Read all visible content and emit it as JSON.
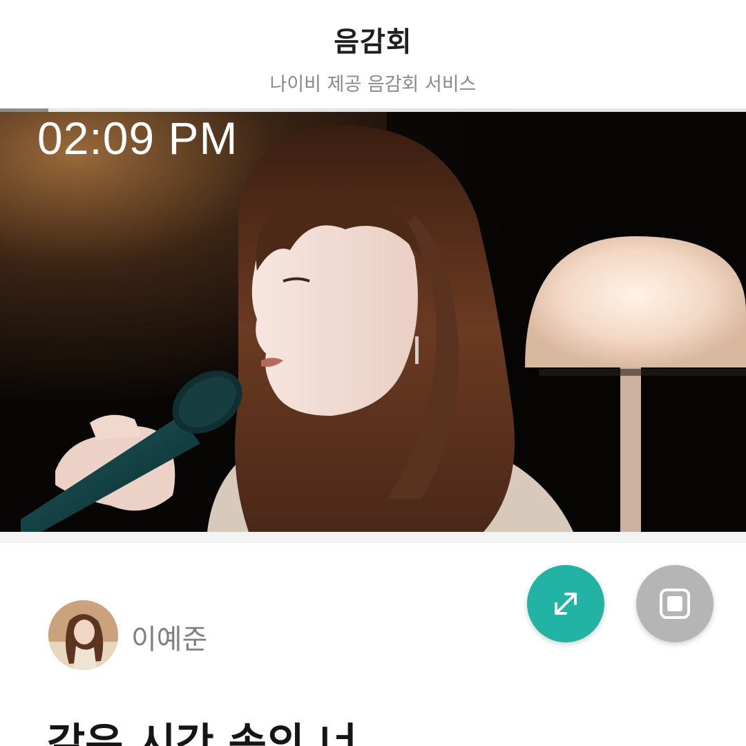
{
  "header": {
    "title": "음감회",
    "subtitle": "나이비 제공 음감회 서비스"
  },
  "player": {
    "progress_fraction": 0.065,
    "overlay_time": "02:09 PM"
  },
  "actions": {
    "expand_icon": "expand-arrows-icon",
    "pip_icon": "picture-in-picture-icon",
    "expand_color": "#22b3a5",
    "pip_color": "#b5b5b5"
  },
  "artist": {
    "name": "이예준"
  },
  "song": {
    "title": "같은 시간 속의 너"
  }
}
